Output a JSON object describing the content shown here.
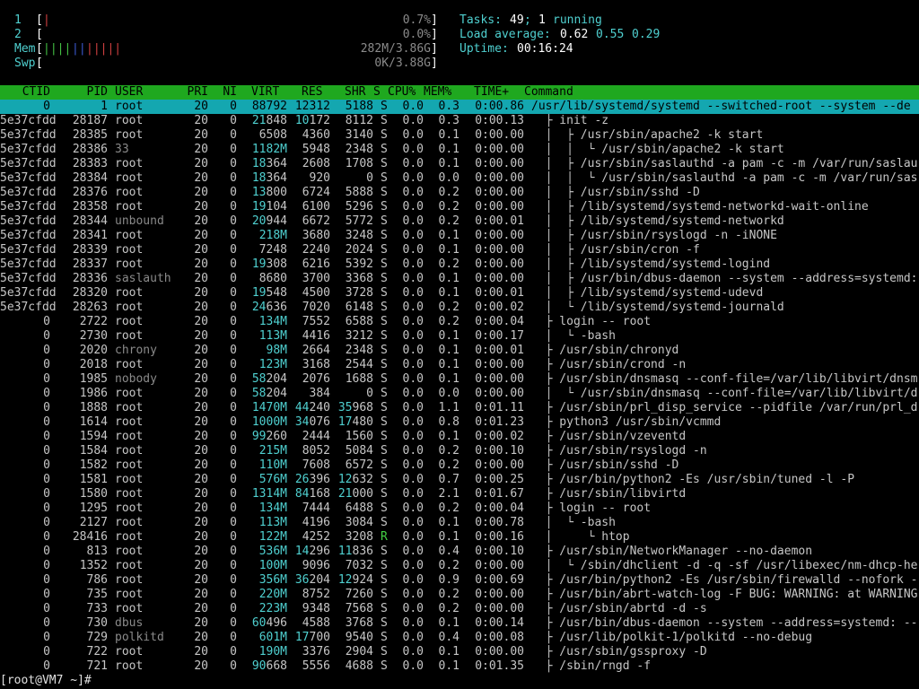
{
  "meters": {
    "cpu1": {
      "label": "1",
      "bar": "|",
      "value": "0.7%"
    },
    "cpu2": {
      "label": "2",
      "bar": "",
      "value": "0.0%"
    },
    "mem": {
      "label": "Mem",
      "bar_green": "||||",
      "bar_blue": "||",
      "bar_red": "|||||",
      "value": "282M/3.86G"
    },
    "swp": {
      "label": "Swp",
      "bar": "",
      "value": "0K/3.88G"
    }
  },
  "summary": {
    "tasks_label": "Tasks:",
    "tasks_count": "49",
    "tasks_sep": ";",
    "running_count": "1",
    "running_label": "running",
    "load_label": "Load average:",
    "load1": "0.62",
    "load5": "0.55",
    "load15": "0.29",
    "uptime_label": "Uptime:",
    "uptime": "00:16:24"
  },
  "columns": {
    "ctid": "CTID",
    "pid": "PID",
    "user": "USER",
    "pri": "PRI",
    "ni": "NI",
    "virt": "VIRT",
    "res": "RES",
    "shr": "SHR",
    "s": "S",
    "cpu": "CPU%",
    "mem": "MEM%",
    "time": "TIME+",
    "command": "Command"
  },
  "processes": [
    {
      "ctid": "0",
      "pid": "1",
      "user": "root",
      "pri": "20",
      "ni": "0",
      "virt": "88792",
      "res": "12312",
      "shr": "5188",
      "s": "S",
      "cpu": "0.0",
      "mem": "0.3",
      "time": "0:00.86",
      "cmd": "/usr/lib/systemd/systemd --switched-root --system --de",
      "selected": true
    },
    {
      "ctid": "5e37cfdd",
      "pid": "28187",
      "user": "root",
      "pri": "20",
      "ni": "0",
      "virt": "21848",
      "res": "10172",
      "shr": "8112",
      "s": "S",
      "cpu": "0.0",
      "mem": "0.3",
      "time": "0:00.13",
      "cmd": "  ├ init -z"
    },
    {
      "ctid": "5e37cfdd",
      "pid": "28385",
      "user": "root",
      "pri": "20",
      "ni": "0",
      "virt": "6508",
      "res": "4360",
      "shr": "3140",
      "s": "S",
      "cpu": "0.0",
      "mem": "0.1",
      "time": "0:00.00",
      "cmd": "  │  ├ /usr/sbin/apache2 -k start"
    },
    {
      "ctid": "5e37cfdd",
      "pid": "28386",
      "user": "33",
      "pri": "20",
      "ni": "0",
      "virt": "1182M",
      "res": "5948",
      "shr": "2348",
      "s": "S",
      "cpu": "0.0",
      "mem": "0.1",
      "time": "0:00.00",
      "cmd": "  │  │  └ /usr/sbin/apache2 -k start"
    },
    {
      "ctid": "5e37cfdd",
      "pid": "28383",
      "user": "root",
      "pri": "20",
      "ni": "0",
      "virt": "18364",
      "res": "2608",
      "shr": "1708",
      "s": "S",
      "cpu": "0.0",
      "mem": "0.1",
      "time": "0:00.00",
      "cmd": "  │  ├ /usr/sbin/saslauthd -a pam -c -m /var/run/saslau"
    },
    {
      "ctid": "5e37cfdd",
      "pid": "28384",
      "user": "root",
      "pri": "20",
      "ni": "0",
      "virt": "18364",
      "res": "920",
      "shr": "0",
      "s": "S",
      "cpu": "0.0",
      "mem": "0.0",
      "time": "0:00.00",
      "cmd": "  │  │  └ /usr/sbin/saslauthd -a pam -c -m /var/run/sas"
    },
    {
      "ctid": "5e37cfdd",
      "pid": "28376",
      "user": "root",
      "pri": "20",
      "ni": "0",
      "virt": "13800",
      "res": "6724",
      "shr": "5888",
      "s": "S",
      "cpu": "0.0",
      "mem": "0.2",
      "time": "0:00.00",
      "cmd": "  │  ├ /usr/sbin/sshd -D"
    },
    {
      "ctid": "5e37cfdd",
      "pid": "28358",
      "user": "root",
      "pri": "20",
      "ni": "0",
      "virt": "19104",
      "res": "6100",
      "shr": "5296",
      "s": "S",
      "cpu": "0.0",
      "mem": "0.2",
      "time": "0:00.00",
      "cmd": "  │  ├ /lib/systemd/systemd-networkd-wait-online"
    },
    {
      "ctid": "5e37cfdd",
      "pid": "28344",
      "user": "unbound",
      "pri": "20",
      "ni": "0",
      "virt": "20944",
      "res": "6672",
      "shr": "5772",
      "s": "S",
      "cpu": "0.0",
      "mem": "0.2",
      "time": "0:00.01",
      "cmd": "  │  ├ /lib/systemd/systemd-networkd"
    },
    {
      "ctid": "5e37cfdd",
      "pid": "28341",
      "user": "root",
      "pri": "20",
      "ni": "0",
      "virt": "218M",
      "res": "3680",
      "shr": "3248",
      "s": "S",
      "cpu": "0.0",
      "mem": "0.1",
      "time": "0:00.00",
      "cmd": "  │  ├ /usr/sbin/rsyslogd -n -iNONE"
    },
    {
      "ctid": "5e37cfdd",
      "pid": "28339",
      "user": "root",
      "pri": "20",
      "ni": "0",
      "virt": "7248",
      "res": "2240",
      "shr": "2024",
      "s": "S",
      "cpu": "0.0",
      "mem": "0.1",
      "time": "0:00.00",
      "cmd": "  │  ├ /usr/sbin/cron -f"
    },
    {
      "ctid": "5e37cfdd",
      "pid": "28337",
      "user": "root",
      "pri": "20",
      "ni": "0",
      "virt": "19308",
      "res": "6216",
      "shr": "5392",
      "s": "S",
      "cpu": "0.0",
      "mem": "0.2",
      "time": "0:00.00",
      "cmd": "  │  ├ /lib/systemd/systemd-logind"
    },
    {
      "ctid": "5e37cfdd",
      "pid": "28336",
      "user": "saslauth",
      "pri": "20",
      "ni": "0",
      "virt": "8680",
      "res": "3700",
      "shr": "3368",
      "s": "S",
      "cpu": "0.0",
      "mem": "0.1",
      "time": "0:00.00",
      "cmd": "  │  ├ /usr/bin/dbus-daemon --system --address=systemd:"
    },
    {
      "ctid": "5e37cfdd",
      "pid": "28320",
      "user": "root",
      "pri": "20",
      "ni": "0",
      "virt": "19548",
      "res": "4500",
      "shr": "3728",
      "s": "S",
      "cpu": "0.0",
      "mem": "0.1",
      "time": "0:00.01",
      "cmd": "  │  ├ /lib/systemd/systemd-udevd"
    },
    {
      "ctid": "5e37cfdd",
      "pid": "28263",
      "user": "root",
      "pri": "20",
      "ni": "0",
      "virt": "24636",
      "res": "7020",
      "shr": "6148",
      "s": "S",
      "cpu": "0.0",
      "mem": "0.2",
      "time": "0:00.02",
      "cmd": "  │  └ /lib/systemd/systemd-journald"
    },
    {
      "ctid": "0",
      "pid": "2722",
      "user": "root",
      "pri": "20",
      "ni": "0",
      "virt": "134M",
      "res": "7552",
      "shr": "6588",
      "s": "S",
      "cpu": "0.0",
      "mem": "0.2",
      "time": "0:00.04",
      "cmd": "  ├ login -- root"
    },
    {
      "ctid": "0",
      "pid": "2730",
      "user": "root",
      "pri": "20",
      "ni": "0",
      "virt": "113M",
      "res": "4416",
      "shr": "3212",
      "s": "S",
      "cpu": "0.0",
      "mem": "0.1",
      "time": "0:00.17",
      "cmd": "  │  └ -bash"
    },
    {
      "ctid": "0",
      "pid": "2020",
      "user": "chrony",
      "pri": "20",
      "ni": "0",
      "virt": "98M",
      "res": "2664",
      "shr": "2348",
      "s": "S",
      "cpu": "0.0",
      "mem": "0.1",
      "time": "0:00.01",
      "cmd": "  ├ /usr/sbin/chronyd"
    },
    {
      "ctid": "0",
      "pid": "2018",
      "user": "root",
      "pri": "20",
      "ni": "0",
      "virt": "123M",
      "res": "3168",
      "shr": "2544",
      "s": "S",
      "cpu": "0.0",
      "mem": "0.1",
      "time": "0:00.00",
      "cmd": "  ├ /usr/sbin/crond -n"
    },
    {
      "ctid": "0",
      "pid": "1985",
      "user": "nobody",
      "pri": "20",
      "ni": "0",
      "virt": "58204",
      "res": "2076",
      "shr": "1688",
      "s": "S",
      "cpu": "0.0",
      "mem": "0.1",
      "time": "0:00.00",
      "cmd": "  ├ /usr/sbin/dnsmasq --conf-file=/var/lib/libvirt/dnsm"
    },
    {
      "ctid": "0",
      "pid": "1986",
      "user": "root",
      "pri": "20",
      "ni": "0",
      "virt": "58204",
      "res": "384",
      "shr": "0",
      "s": "S",
      "cpu": "0.0",
      "mem": "0.0",
      "time": "0:00.00",
      "cmd": "  │  └ /usr/sbin/dnsmasq --conf-file=/var/lib/libvirt/d"
    },
    {
      "ctid": "0",
      "pid": "1888",
      "user": "root",
      "pri": "20",
      "ni": "0",
      "virt": "1470M",
      "res": "44240",
      "shr": "35968",
      "s": "S",
      "cpu": "0.0",
      "mem": "1.1",
      "time": "0:01.11",
      "cmd": "  ├ /usr/sbin/prl_disp_service --pidfile /var/run/prl_d"
    },
    {
      "ctid": "0",
      "pid": "1614",
      "user": "root",
      "pri": "20",
      "ni": "0",
      "virt": "1000M",
      "res": "34076",
      "shr": "17480",
      "s": "S",
      "cpu": "0.0",
      "mem": "0.8",
      "time": "0:01.23",
      "cmd": "  ├ python3 /usr/sbin/vcmmd"
    },
    {
      "ctid": "0",
      "pid": "1594",
      "user": "root",
      "pri": "20",
      "ni": "0",
      "virt": "99260",
      "res": "2444",
      "shr": "1560",
      "s": "S",
      "cpu": "0.0",
      "mem": "0.1",
      "time": "0:00.02",
      "cmd": "  ├ /usr/sbin/vzeventd"
    },
    {
      "ctid": "0",
      "pid": "1584",
      "user": "root",
      "pri": "20",
      "ni": "0",
      "virt": "215M",
      "res": "8052",
      "shr": "5084",
      "s": "S",
      "cpu": "0.0",
      "mem": "0.2",
      "time": "0:00.10",
      "cmd": "  ├ /usr/sbin/rsyslogd -n"
    },
    {
      "ctid": "0",
      "pid": "1582",
      "user": "root",
      "pri": "20",
      "ni": "0",
      "virt": "110M",
      "res": "7608",
      "shr": "6572",
      "s": "S",
      "cpu": "0.0",
      "mem": "0.2",
      "time": "0:00.00",
      "cmd": "  ├ /usr/sbin/sshd -D"
    },
    {
      "ctid": "0",
      "pid": "1581",
      "user": "root",
      "pri": "20",
      "ni": "0",
      "virt": "576M",
      "res": "26396",
      "shr": "12632",
      "s": "S",
      "cpu": "0.0",
      "mem": "0.7",
      "time": "0:00.25",
      "cmd": "  ├ /usr/bin/python2 -Es /usr/sbin/tuned -l -P"
    },
    {
      "ctid": "0",
      "pid": "1580",
      "user": "root",
      "pri": "20",
      "ni": "0",
      "virt": "1314M",
      "res": "84168",
      "shr": "21000",
      "s": "S",
      "cpu": "0.0",
      "mem": "2.1",
      "time": "0:01.67",
      "cmd": "  ├ /usr/sbin/libvirtd"
    },
    {
      "ctid": "0",
      "pid": "1295",
      "user": "root",
      "pri": "20",
      "ni": "0",
      "virt": "134M",
      "res": "7444",
      "shr": "6488",
      "s": "S",
      "cpu": "0.0",
      "mem": "0.2",
      "time": "0:00.04",
      "cmd": "  ├ login -- root"
    },
    {
      "ctid": "0",
      "pid": "2127",
      "user": "root",
      "pri": "20",
      "ni": "0",
      "virt": "113M",
      "res": "4196",
      "shr": "3084",
      "s": "S",
      "cpu": "0.0",
      "mem": "0.1",
      "time": "0:00.78",
      "cmd": "  │  └ -bash"
    },
    {
      "ctid": "0",
      "pid": "28416",
      "user": "root",
      "pri": "20",
      "ni": "0",
      "virt": "122M",
      "res": "4252",
      "shr": "3208",
      "s": "R",
      "cpu": "0.0",
      "mem": "0.1",
      "time": "0:00.16",
      "cmd": "  │     └ htop"
    },
    {
      "ctid": "0",
      "pid": "813",
      "user": "root",
      "pri": "20",
      "ni": "0",
      "virt": "536M",
      "res": "14296",
      "shr": "11836",
      "s": "S",
      "cpu": "0.0",
      "mem": "0.4",
      "time": "0:00.10",
      "cmd": "  ├ /usr/sbin/NetworkManager --no-daemon"
    },
    {
      "ctid": "0",
      "pid": "1352",
      "user": "root",
      "pri": "20",
      "ni": "0",
      "virt": "100M",
      "res": "9096",
      "shr": "7032",
      "s": "S",
      "cpu": "0.0",
      "mem": "0.2",
      "time": "0:00.00",
      "cmd": "  │  └ /sbin/dhclient -d -q -sf /usr/libexec/nm-dhcp-he"
    },
    {
      "ctid": "0",
      "pid": "786",
      "user": "root",
      "pri": "20",
      "ni": "0",
      "virt": "356M",
      "res": "36204",
      "shr": "12924",
      "s": "S",
      "cpu": "0.0",
      "mem": "0.9",
      "time": "0:00.69",
      "cmd": "  ├ /usr/bin/python2 -Es /usr/sbin/firewalld --nofork -"
    },
    {
      "ctid": "0",
      "pid": "735",
      "user": "root",
      "pri": "20",
      "ni": "0",
      "virt": "220M",
      "res": "8752",
      "shr": "7260",
      "s": "S",
      "cpu": "0.0",
      "mem": "0.2",
      "time": "0:00.00",
      "cmd": "  ├ /usr/bin/abrt-watch-log -F BUG: WARNING: at WARNING"
    },
    {
      "ctid": "0",
      "pid": "733",
      "user": "root",
      "pri": "20",
      "ni": "0",
      "virt": "223M",
      "res": "9348",
      "shr": "7568",
      "s": "S",
      "cpu": "0.0",
      "mem": "0.2",
      "time": "0:00.00",
      "cmd": "  ├ /usr/sbin/abrtd -d -s"
    },
    {
      "ctid": "0",
      "pid": "730",
      "user": "dbus",
      "pri": "20",
      "ni": "0",
      "virt": "60496",
      "res": "4588",
      "shr": "3768",
      "s": "S",
      "cpu": "0.0",
      "mem": "0.1",
      "time": "0:00.14",
      "cmd": "  ├ /usr/bin/dbus-daemon --system --address=systemd: --"
    },
    {
      "ctid": "0",
      "pid": "729",
      "user": "polkitd",
      "pri": "20",
      "ni": "0",
      "virt": "601M",
      "res": "17700",
      "shr": "9540",
      "s": "S",
      "cpu": "0.0",
      "mem": "0.4",
      "time": "0:00.08",
      "cmd": "  ├ /usr/lib/polkit-1/polkitd --no-debug"
    },
    {
      "ctid": "0",
      "pid": "722",
      "user": "root",
      "pri": "20",
      "ni": "0",
      "virt": "190M",
      "res": "3376",
      "shr": "2904",
      "s": "S",
      "cpu": "0.0",
      "mem": "0.1",
      "time": "0:00.00",
      "cmd": "  ├ /usr/sbin/gssproxy -D"
    },
    {
      "ctid": "0",
      "pid": "721",
      "user": "root",
      "pri": "20",
      "ni": "0",
      "virt": "90668",
      "res": "5556",
      "shr": "4688",
      "s": "S",
      "cpu": "0.0",
      "mem": "0.1",
      "time": "0:01.35",
      "cmd": "  ├ /sbin/rngd -f"
    }
  ],
  "prompt": "[root@VM7 ~]#",
  "colors": {
    "header_bg": "#1fa81f",
    "selected_bg": "#14a7b0",
    "accent": "#4fd0d0"
  }
}
